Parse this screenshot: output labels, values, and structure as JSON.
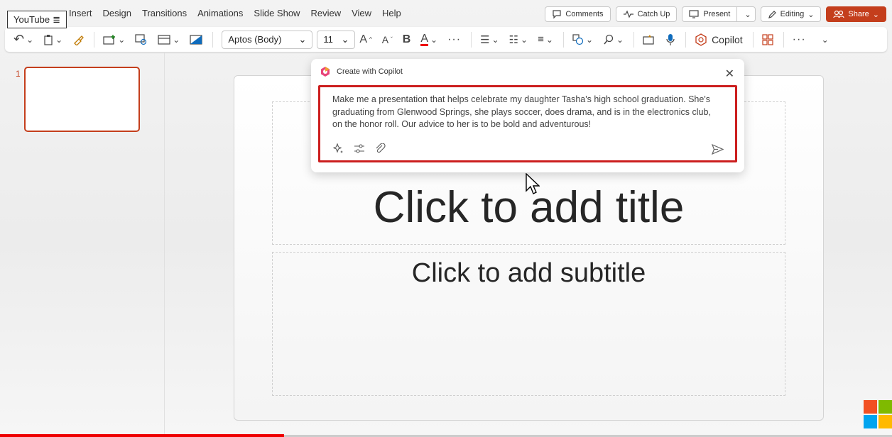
{
  "youtube_badge": "YouTube",
  "menu": [
    "Insert",
    "Design",
    "Transitions",
    "Animations",
    "Slide Show",
    "Review",
    "View",
    "Help"
  ],
  "top_actions": {
    "comments": "Comments",
    "catch_up": "Catch Up",
    "present": "Present",
    "editing": "Editing",
    "share": "Share"
  },
  "ribbon": {
    "font_name": "Aptos (Body)",
    "font_size": "11",
    "copilot": "Copilot"
  },
  "thumbnails": {
    "slide_number": "1"
  },
  "slide": {
    "title_placeholder": "Click to add title",
    "subtitle_placeholder": "Click to add subtitle"
  },
  "copilot_dialog": {
    "title": "Create with Copilot",
    "prompt": "Make me a presentation that helps celebrate my daughter Tasha's high school graduation. She's graduating from Glenwood Springs, she plays soccer, does drama, and is in the electronics club, on the honor roll. Our advice to her is to be bold and adventurous!"
  },
  "colors": {
    "accent": "#c43e1c",
    "highlight": "#cc1e1e"
  }
}
